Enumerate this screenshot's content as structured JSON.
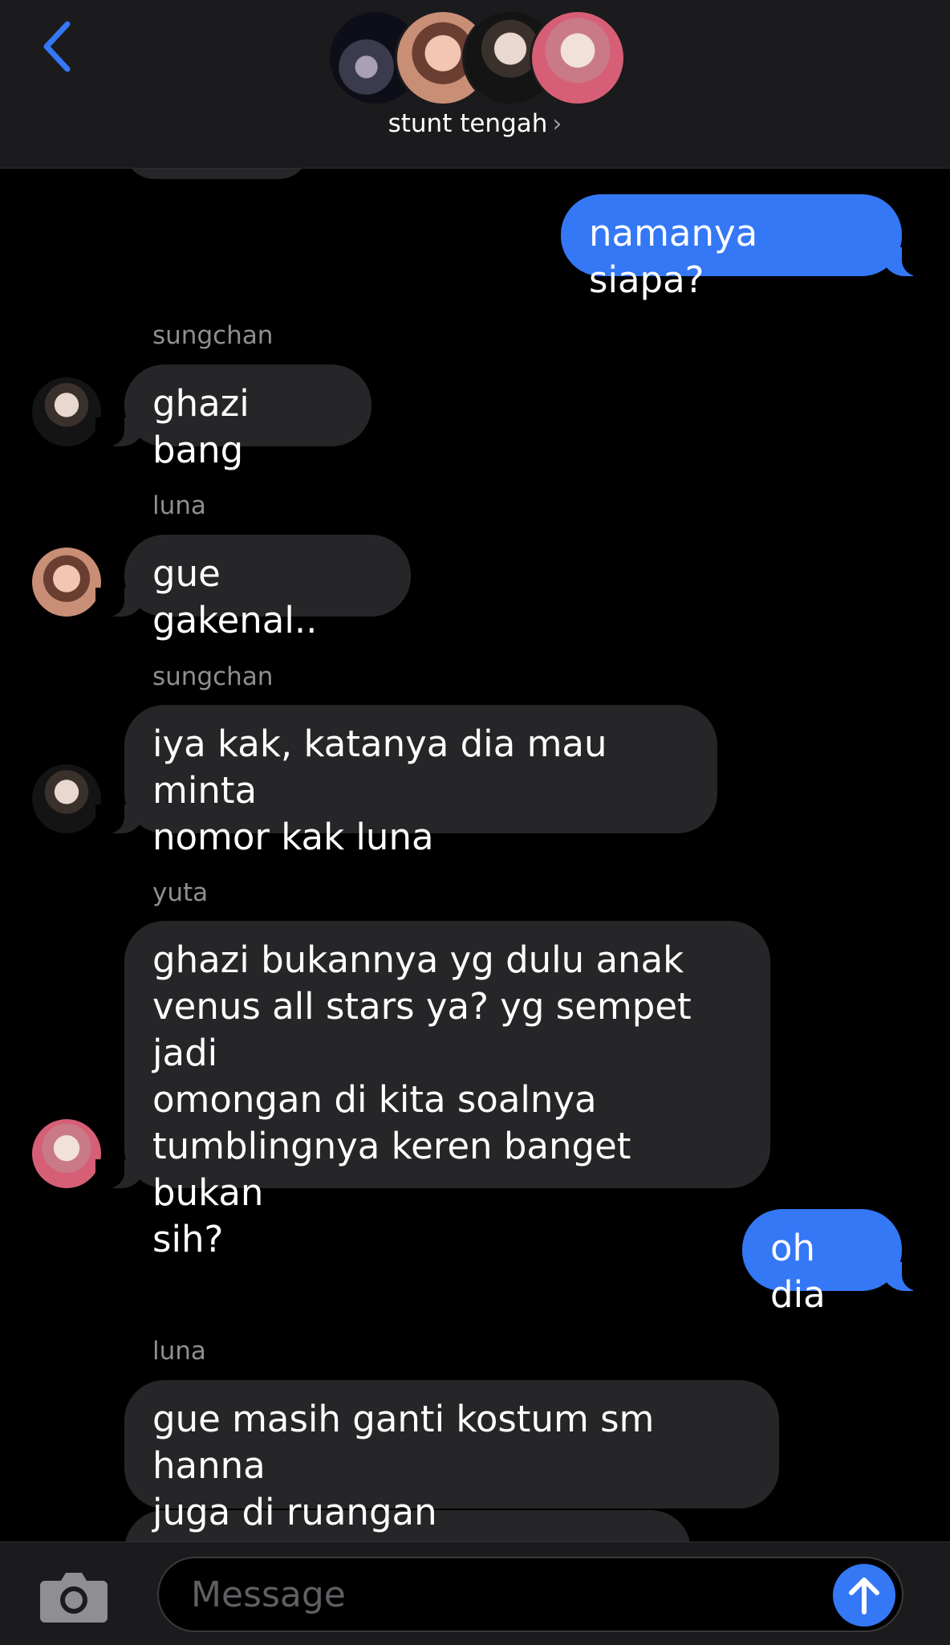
{
  "header": {
    "group_name": "stunt tengah",
    "chevron": "›",
    "back_icon": "chevron-left-icon",
    "accent": "#3478f6"
  },
  "messages": [
    {
      "direction": "outgoing",
      "text": "namanya siapa?"
    },
    {
      "direction": "incoming",
      "sender": "sungchan",
      "text": "ghazi bang"
    },
    {
      "direction": "incoming",
      "sender": "luna",
      "text": "gue gakenal.."
    },
    {
      "direction": "incoming",
      "sender": "sungchan",
      "text": "iya kak, katanya dia mau minta\nnomor kak luna"
    },
    {
      "direction": "incoming",
      "sender": "yuta",
      "text": "ghazi bukannya yg dulu anak\nvenus all stars ya? yg sempet jadi\nomongan di kita soalnya\ntumblingnya keren banget bukan\nsih?"
    },
    {
      "direction": "outgoing",
      "text": "oh dia"
    },
    {
      "direction": "incoming",
      "sender": "luna",
      "text": "gue masih ganti kostum sm hanna\njuga di ruangan"
    }
  ],
  "composer": {
    "placeholder": "Message",
    "camera_icon": "camera-icon",
    "send_icon": "arrow-up-icon"
  }
}
